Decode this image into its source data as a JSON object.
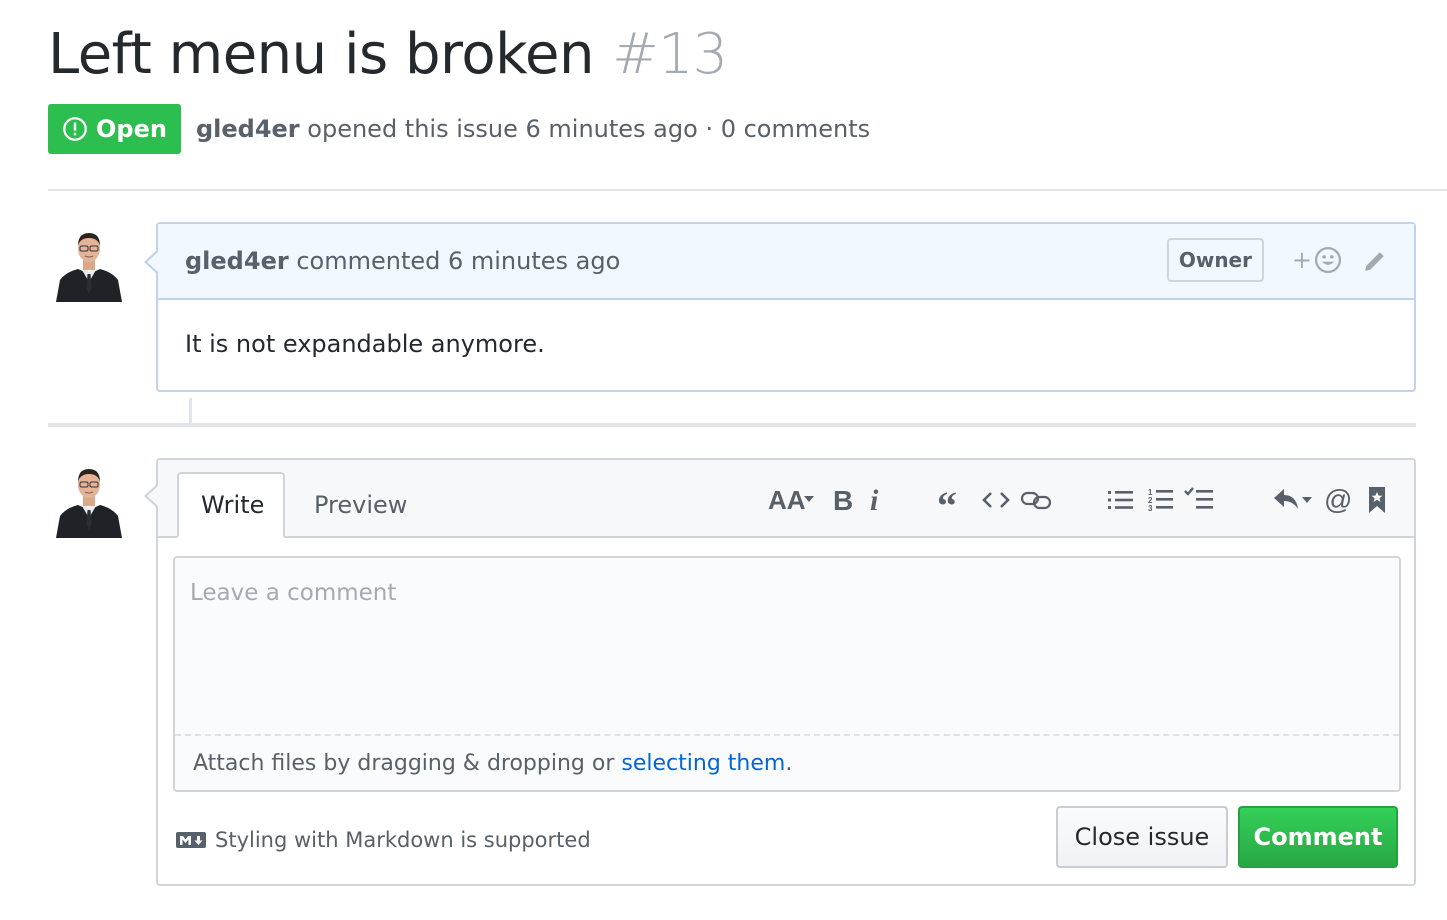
{
  "issue": {
    "title": "Left menu is broken",
    "number": "#13",
    "state": "Open",
    "author": "gled4er",
    "meta_rest": "opened this issue 6 minutes ago · 0 comments"
  },
  "comment": {
    "author": "gled4er",
    "action": "commented 6 minutes ago",
    "role_badge": "Owner",
    "reaction_plus": "+",
    "body": "It is not expandable anymore."
  },
  "editor": {
    "tabs": [
      {
        "label": "Write",
        "active": true
      },
      {
        "label": "Preview",
        "active": false
      }
    ],
    "toolbar_icons": [
      "text-size-icon",
      "bold-icon",
      "italic-icon",
      "quote-icon",
      "code-icon",
      "link-icon",
      "bullet-list-icon",
      "numbered-list-icon",
      "task-list-icon",
      "reply-icon",
      "mention-icon",
      "saved-reply-icon"
    ],
    "placeholder": "Leave a comment",
    "attach_text": "Attach files by dragging & dropping or",
    "attach_link": "selecting them",
    "attach_end": ".",
    "markdown_hint": "Styling with Markdown is supported",
    "close_button": "Close issue",
    "comment_button": "Comment"
  },
  "colors": {
    "open_green": "#2cbe4e",
    "link_blue": "#0366d6",
    "comment_header_bg": "#f1f8ff",
    "comment_border": "#c0d3eb"
  }
}
